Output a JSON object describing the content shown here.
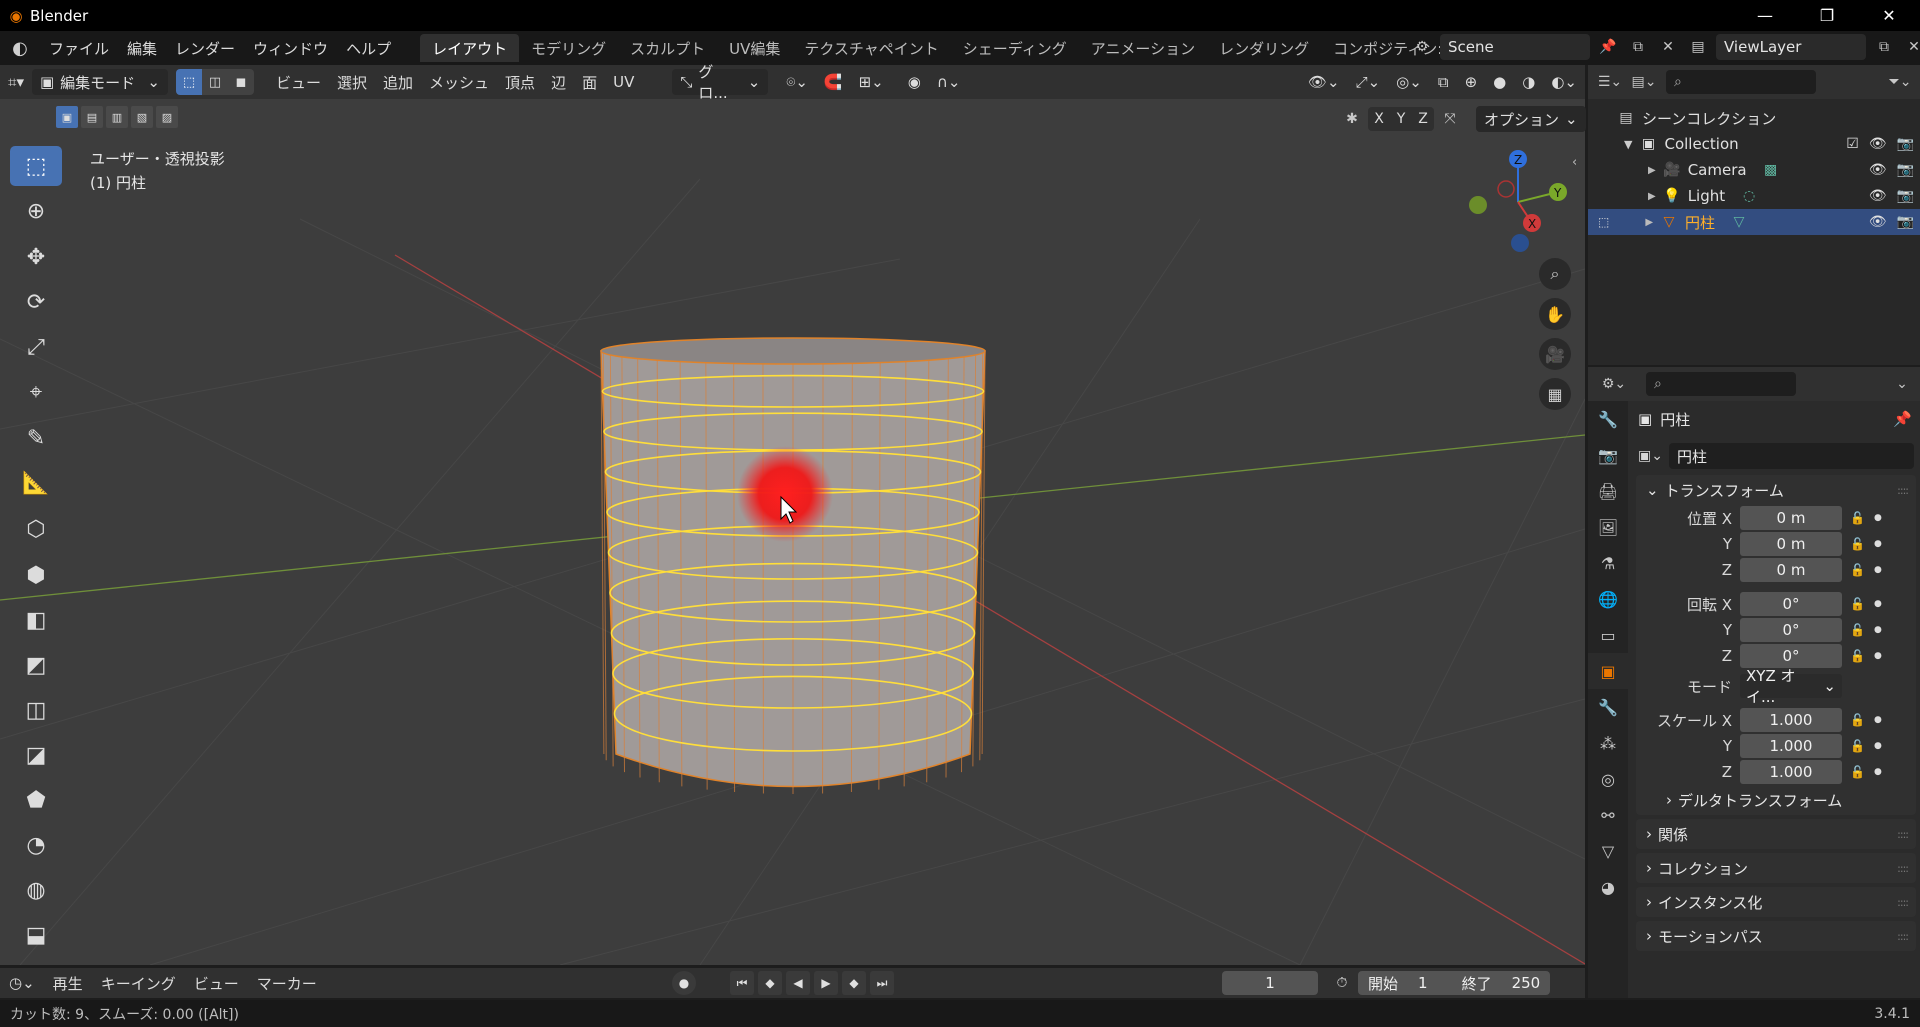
{
  "window": {
    "title": "Blender",
    "min": "—",
    "max": "❐",
    "close": "✕"
  },
  "menu": [
    "ファイル",
    "編集",
    "レンダー",
    "ウィンドウ",
    "ヘルプ"
  ],
  "workspaces": [
    "レイアウト",
    "モデリング",
    "スカルプト",
    "UV編集",
    "テクスチャペイント",
    "シェーディング",
    "アニメーション",
    "レンダリング",
    "コンポジティン:"
  ],
  "scene": {
    "name": "Scene",
    "view_layer": "ViewLayer"
  },
  "viewport_header": {
    "mode": "編集モード",
    "menus": [
      "ビュー",
      "選択",
      "追加",
      "メッシュ",
      "頂点",
      "辺",
      "面",
      "UV"
    ],
    "transform_orientation": "グロ...",
    "options": "オプション",
    "axes": [
      "X",
      "Y",
      "Z"
    ]
  },
  "viewport": {
    "info_line1": "ユーザー・透視投影",
    "info_line2": "(1) 円柱"
  },
  "gizmo": {
    "x": "X",
    "y": "Y",
    "z": "Z"
  },
  "outliner": {
    "scene_collection": "シーンコレクション",
    "collection": "Collection",
    "items": [
      {
        "name": "Camera",
        "icon": "camera-icon"
      },
      {
        "name": "Light",
        "icon": "light-icon"
      },
      {
        "name": "円柱",
        "icon": "mesh-icon",
        "selected": true
      }
    ]
  },
  "properties": {
    "object_name_title": "円柱",
    "object_name_field": "円柱",
    "transform_label": "トランスフォーム",
    "location_label": "位置 X",
    "rotation_label": "回転 X",
    "scale_label": "スケール X",
    "y_label": "Y",
    "z_label": "Z",
    "mode_label": "モード",
    "location": [
      "0 m",
      "0 m",
      "0 m"
    ],
    "rotation": [
      "0°",
      "0°",
      "0°"
    ],
    "rotation_mode": "XYZ オイ...",
    "scale": [
      "1.000",
      "1.000",
      "1.000"
    ],
    "delta": "デルタトランスフォーム",
    "panels": [
      "関係",
      "コレクション",
      "インスタンス化",
      "モーションパス"
    ]
  },
  "timeline": {
    "playback": "再生",
    "keying": "キーイング",
    "view": "ビュー",
    "marker": "マーカー",
    "current_frame": "1",
    "start_label": "開始",
    "start": "1",
    "end_label": "終了",
    "end": "250"
  },
  "statusbar": {
    "text": "カット数: 9、スムーズ: 0.00 ([Alt])",
    "version": "3.4.1"
  },
  "colors": {
    "accent": "#4772b3",
    "orange": "#ea7600",
    "edge_yellow": "#ffde3a"
  }
}
